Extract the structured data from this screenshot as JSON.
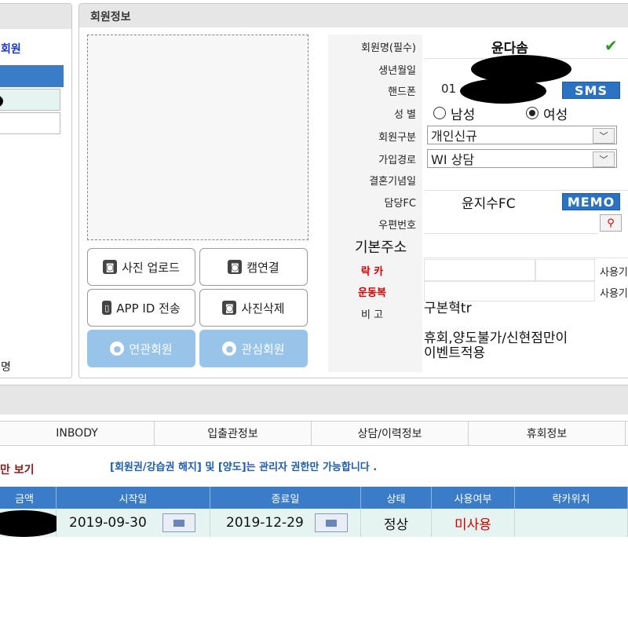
{
  "left_panel": {
    "link_label": "회원",
    "bottom_label": "명"
  },
  "member_panel": {
    "title": "회원정보",
    "photo_buttons": {
      "upload": "사진 업로드",
      "cam": "캠연결",
      "app_id": "APP ID 전송",
      "delete": "사진삭제",
      "related": "연관회원",
      "interest": "관심회원"
    },
    "fields": {
      "name_label": "회원명(필수)",
      "name_value": "윤다솜",
      "birth_label": "생년월일",
      "phone_label": "핸드폰",
      "phone_partial": "01",
      "sms_button": "SMS",
      "gender_label": "성 별",
      "gender_male": "남성",
      "gender_female": "여성",
      "gender_selected": "여성",
      "member_type_label": "회원구분",
      "member_type_value": "개인신규",
      "join_route_label": "가입경로",
      "join_route_value": "WI 상담",
      "anniversary_label": "결혼기념일",
      "fc_label": "담당FC",
      "fc_value": "윤지수FC",
      "memo_button": "MEMO",
      "zip_label": "우편번호",
      "address_label": "기본주소",
      "locker_label": "락 카",
      "locker_use": "사용기",
      "uniform_label": "운동복",
      "uniform_use": "사용기",
      "note_label": "비 고",
      "note_line1": "구본혁tr",
      "note_line2": "휴회,양도불가/신현점만이",
      "note_line3": "이벤트적용"
    }
  },
  "tabs": [
    "INBODY",
    "입출관정보",
    "상담/이력정보",
    "휴회정보"
  ],
  "subbar": {
    "left_text": "만 보기",
    "notice": "[회원권/강습권 해지] 및 [양도]는 관리자 권한만 가능합니다 ."
  },
  "table": {
    "headers": [
      "금액",
      "시작일",
      "종료일",
      "상태",
      "사용여부",
      "락카위치"
    ],
    "row": {
      "start_date": "2019-09-30",
      "end_date": "2019-12-29",
      "status": "정상",
      "usage": "미사용",
      "locker": ""
    }
  },
  "colors": {
    "accent_blue": "#2b73c2",
    "header_blue": "#3a7cc8",
    "warning_red": "#d40000",
    "row_bg": "#e5f4f1"
  }
}
